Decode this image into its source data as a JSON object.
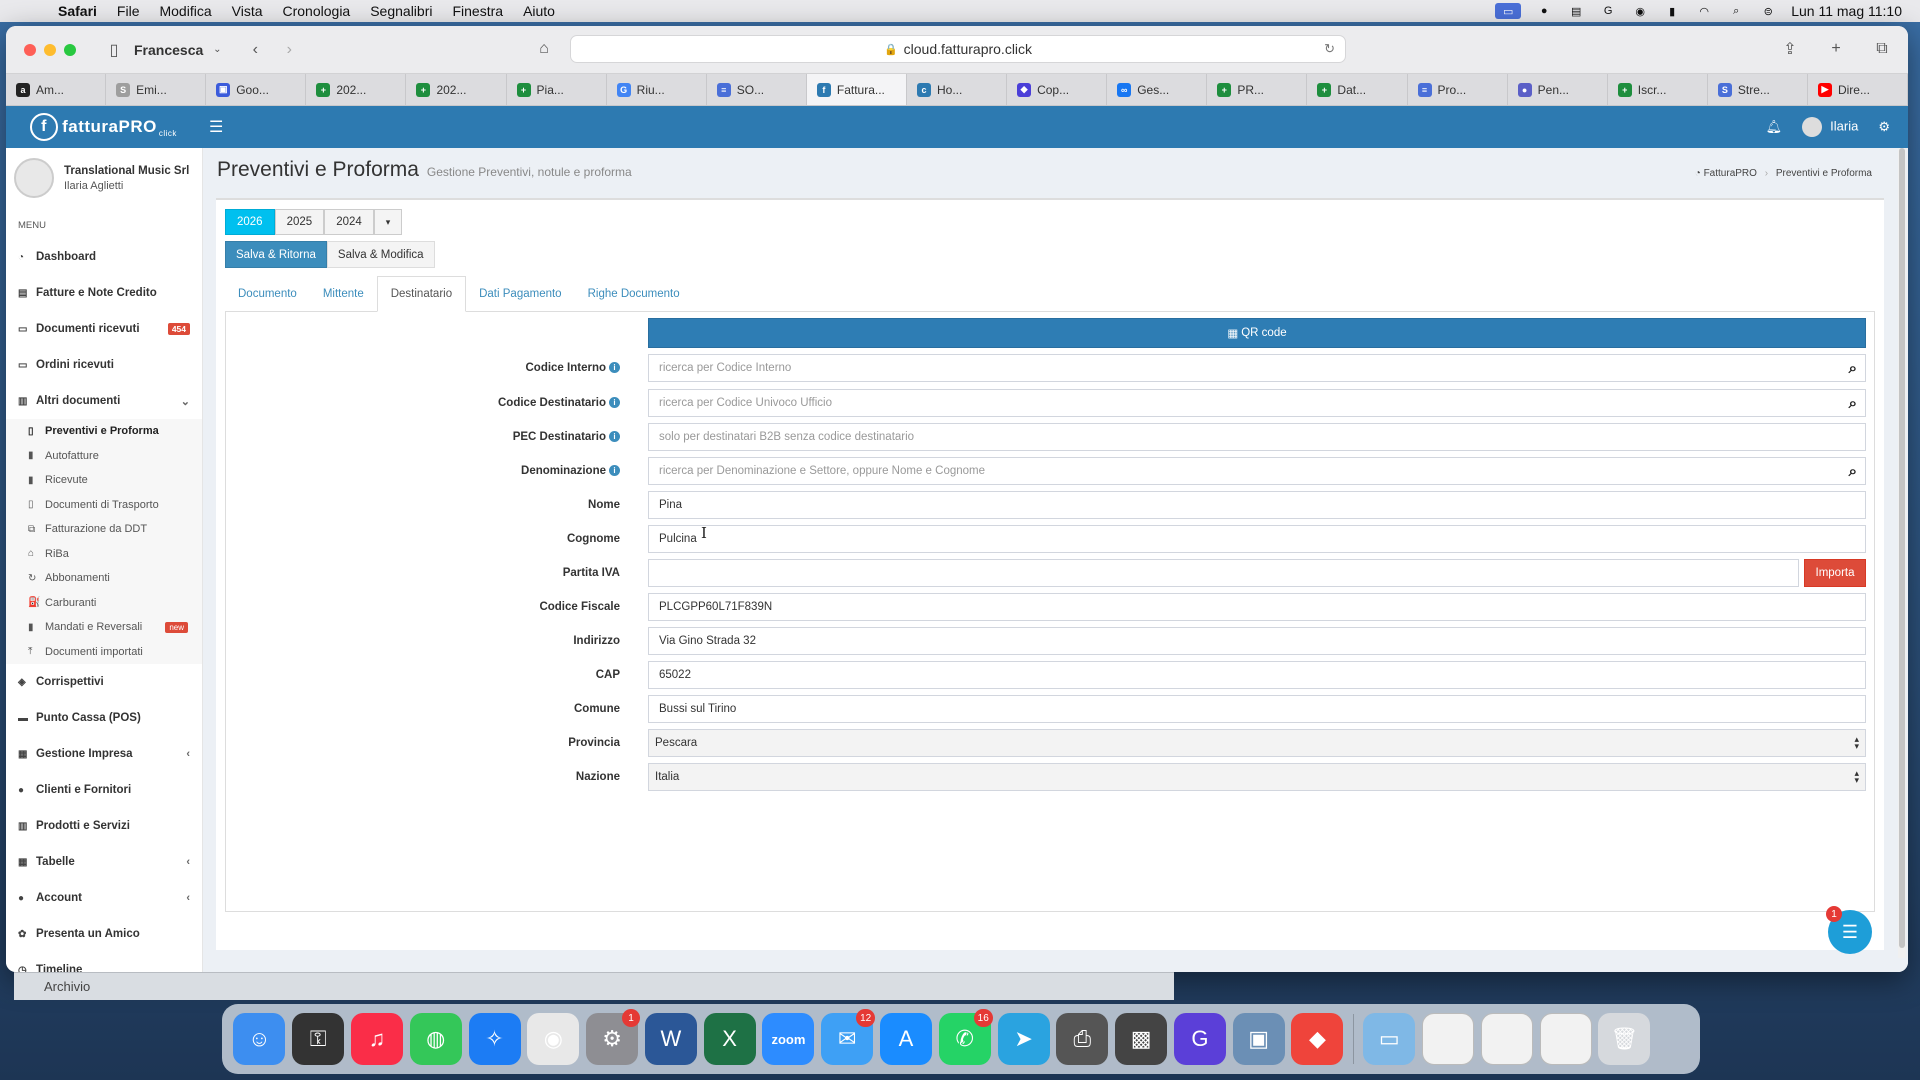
{
  "menubar": {
    "app": "Safari",
    "items": [
      "File",
      "Modifica",
      "Vista",
      "Cronologia",
      "Segnalibri",
      "Finestra",
      "Aiuto"
    ],
    "clock": "Lun 11 mag  11:10"
  },
  "browser": {
    "profile": "Francesca",
    "url": "cloud.fatturapro.click",
    "tabs": [
      {
        "label": "Am...",
        "color": "#222222",
        "glyph": "a"
      },
      {
        "label": "Emi...",
        "color": "#9e9e9e",
        "glyph": "S"
      },
      {
        "label": "Goo...",
        "color": "#3b5bdb",
        "glyph": "▣"
      },
      {
        "label": "202...",
        "color": "#1e8e3e",
        "glyph": "+"
      },
      {
        "label": "202...",
        "color": "#1e8e3e",
        "glyph": "+"
      },
      {
        "label": "Pia...",
        "color": "#1e8e3e",
        "glyph": "+"
      },
      {
        "label": "Riu...",
        "color": "#4285f4",
        "glyph": "G"
      },
      {
        "label": "SO...",
        "color": "#4a6fd8",
        "glyph": "≡"
      },
      {
        "label": "Fattura...",
        "color": "#2d7ab1",
        "glyph": "f"
      },
      {
        "label": "Ho...",
        "color": "#2d7ab1",
        "glyph": "c"
      },
      {
        "label": "Cop...",
        "color": "#4b3fd8",
        "glyph": "◆"
      },
      {
        "label": "Ges...",
        "color": "#1877f2",
        "glyph": "∞"
      },
      {
        "label": "PR...",
        "color": "#1e8e3e",
        "glyph": "+"
      },
      {
        "label": "Dat...",
        "color": "#1e8e3e",
        "glyph": "+"
      },
      {
        "label": "Pro...",
        "color": "#4a6fd8",
        "glyph": "≡"
      },
      {
        "label": "Pen...",
        "color": "#5b5fc7",
        "glyph": "●"
      },
      {
        "label": "Iscr...",
        "color": "#1e8e3e",
        "glyph": "+"
      },
      {
        "label": "Stre...",
        "color": "#4a6fd8",
        "glyph": "S"
      },
      {
        "label": "Dire...",
        "color": "#ff0000",
        "glyph": "▶"
      }
    ],
    "active_tab": 8
  },
  "app": {
    "logo": "fatturaPRO",
    "logo_sub": "click",
    "user_top": "Ilaria"
  },
  "sidebar": {
    "company": "Translational Music Srl",
    "user": "Ilaria Aglietti",
    "menu_header": "MENU",
    "items_top": [
      {
        "label": "Dashboard",
        "icon": "◔",
        "name": "dashboard"
      },
      {
        "label": "Fatture e Note Credito",
        "icon": "▤",
        "name": "fatture"
      },
      {
        "label": "Documenti ricevuti",
        "icon": "▭",
        "name": "documenti-ricevuti",
        "badge": "454"
      },
      {
        "label": "Ordini ricevuti",
        "icon": "▭",
        "name": "ordini-ricevuti"
      },
      {
        "label": "Altri documenti",
        "icon": "▥",
        "name": "altri-documenti",
        "arrow": "⌄"
      }
    ],
    "submenu": [
      {
        "label": "Preventivi e Proforma",
        "icon": "▯",
        "current": true
      },
      {
        "label": "Autofatture",
        "icon": "▮"
      },
      {
        "label": "Ricevute",
        "icon": "▮"
      },
      {
        "label": "Documenti di Trasporto",
        "icon": "▯"
      },
      {
        "label": "Fatturazione da DDT",
        "icon": "⧉"
      },
      {
        "label": "RiBa",
        "icon": "⌂"
      },
      {
        "label": "Abbonamenti",
        "icon": "↻"
      },
      {
        "label": "Carburanti",
        "icon": "⛽"
      },
      {
        "label": "Mandati e Reversali",
        "icon": "▮",
        "badge": "new"
      },
      {
        "label": "Documenti importati",
        "icon": "⤒"
      }
    ],
    "items_bottom": [
      {
        "label": "Corrispettivi",
        "icon": "◈",
        "name": "corrispettivi"
      },
      {
        "label": "Punto Cassa (POS)",
        "icon": "▬",
        "name": "punto-cassa"
      },
      {
        "label": "Gestione Impresa",
        "icon": "▦",
        "name": "gestione-impresa",
        "arrow": "‹"
      },
      {
        "label": "Clienti e Fornitori",
        "icon": "●",
        "name": "clienti-fornitori"
      },
      {
        "label": "Prodotti e Servizi",
        "icon": "▥",
        "name": "prodotti-servizi"
      },
      {
        "label": "Tabelle",
        "icon": "▦",
        "name": "tabelle",
        "arrow": "‹"
      },
      {
        "label": "Account",
        "icon": "●",
        "name": "account",
        "arrow": "‹"
      },
      {
        "label": "Presenta un Amico",
        "icon": "✿",
        "name": "presenta-amico"
      },
      {
        "label": "Timeline",
        "icon": "◷",
        "name": "timeline"
      }
    ]
  },
  "page": {
    "title": "Preventivi e Proforma",
    "subtitle": "Gestione Preventivi, notule e proforma",
    "breadcrumb_home": "FatturaPRO",
    "breadcrumb_current": "Preventivi e Proforma"
  },
  "years": [
    "2026",
    "2025",
    "2024"
  ],
  "buttons": {
    "save_return": "Salva & Ritorna",
    "save_edit": "Salva & Modifica",
    "qr": "QR code",
    "import": "Importa"
  },
  "tabs": [
    "Documento",
    "Mittente",
    "Destinatario",
    "Dati Pagamento",
    "Righe Documento"
  ],
  "active_tab": 2,
  "form": [
    {
      "label": "Codice Interno",
      "info": true,
      "placeholder": "ricerca per Codice Interno",
      "value": "",
      "search": true
    },
    {
      "label": "Codice Destinatario",
      "info": true,
      "placeholder": "ricerca per Codice Univoco Ufficio",
      "value": "",
      "search": true
    },
    {
      "label": "PEC Destinatario",
      "info": true,
      "placeholder": "solo per destinatari B2B senza codice destinatario",
      "value": ""
    },
    {
      "label": "Denominazione",
      "info": true,
      "placeholder": "ricerca per Denominazione e Settore, oppure Nome e Cognome",
      "value": "",
      "search": true
    },
    {
      "label": "Nome",
      "value": "Pina"
    },
    {
      "label": "Cognome",
      "value": "Pulcina"
    },
    {
      "label": "Partita IVA",
      "value": "",
      "import": true
    },
    {
      "label": "Codice Fiscale",
      "value": "PLCGPP60L71F839N"
    },
    {
      "label": "Indirizzo",
      "value": "Via Gino Strada 32"
    },
    {
      "label": "CAP",
      "value": "65022"
    },
    {
      "label": "Comune",
      "value": "Bussi sul Tirino"
    },
    {
      "label": "Provincia",
      "value": "Pescara",
      "select": true
    },
    {
      "label": "Nazione",
      "value": "Italia",
      "select": true
    }
  ],
  "chat_badge": "1",
  "behind_window": "Archivio",
  "dock": [
    {
      "name": "finder",
      "bg": "#3d8ef0",
      "glyph": "☺"
    },
    {
      "name": "launchpad",
      "bg": "#333333",
      "glyph": "⚿"
    },
    {
      "name": "music",
      "bg": "#fa2d48",
      "glyph": "♫"
    },
    {
      "name": "messages",
      "bg": "#34c759",
      "glyph": "◍"
    },
    {
      "name": "safari",
      "bg": "#1c7cf4",
      "glyph": "✧"
    },
    {
      "name": "chrome",
      "bg": "#e8e8e8",
      "glyph": "◉"
    },
    {
      "name": "settings",
      "bg": "#8e8e93",
      "glyph": "⚙",
      "badge": "1"
    },
    {
      "name": "word",
      "bg": "#2b5797",
      "glyph": "W"
    },
    {
      "name": "excel",
      "bg": "#1e7145",
      "glyph": "X"
    },
    {
      "name": "zoom",
      "bg": "#2d8cff",
      "glyph": "zoom"
    },
    {
      "name": "mail",
      "bg": "#3ea0f5",
      "glyph": "✉",
      "badge": "12"
    },
    {
      "name": "app-store",
      "bg": "#1a8cff",
      "glyph": "A"
    },
    {
      "name": "whatsapp",
      "bg": "#25d366",
      "glyph": "✆",
      "badge": "16"
    },
    {
      "name": "telegram",
      "bg": "#2aa3e0",
      "glyph": "➤"
    },
    {
      "name": "printer",
      "bg": "#555555",
      "glyph": "⎙"
    },
    {
      "name": "photo-booth",
      "bg": "#444444",
      "glyph": "▩"
    },
    {
      "name": "grammarly",
      "bg": "#5b3fd8",
      "glyph": "G"
    },
    {
      "name": "preview",
      "bg": "#6b8fb5",
      "glyph": "▣"
    },
    {
      "name": "anydesk",
      "bg": "#ef443b",
      "glyph": "◆"
    },
    {
      "name": "folder",
      "bg": "#7fb8e6",
      "glyph": "▭"
    },
    {
      "name": "window-1",
      "bg": "#f2f2f2",
      "glyph": ""
    },
    {
      "name": "window-2",
      "bg": "#f2f2f2",
      "glyph": ""
    },
    {
      "name": "window-3",
      "bg": "#f2f2f2",
      "glyph": ""
    },
    {
      "name": "trash",
      "bg": "#d6d9dd",
      "glyph": "🗑"
    }
  ]
}
